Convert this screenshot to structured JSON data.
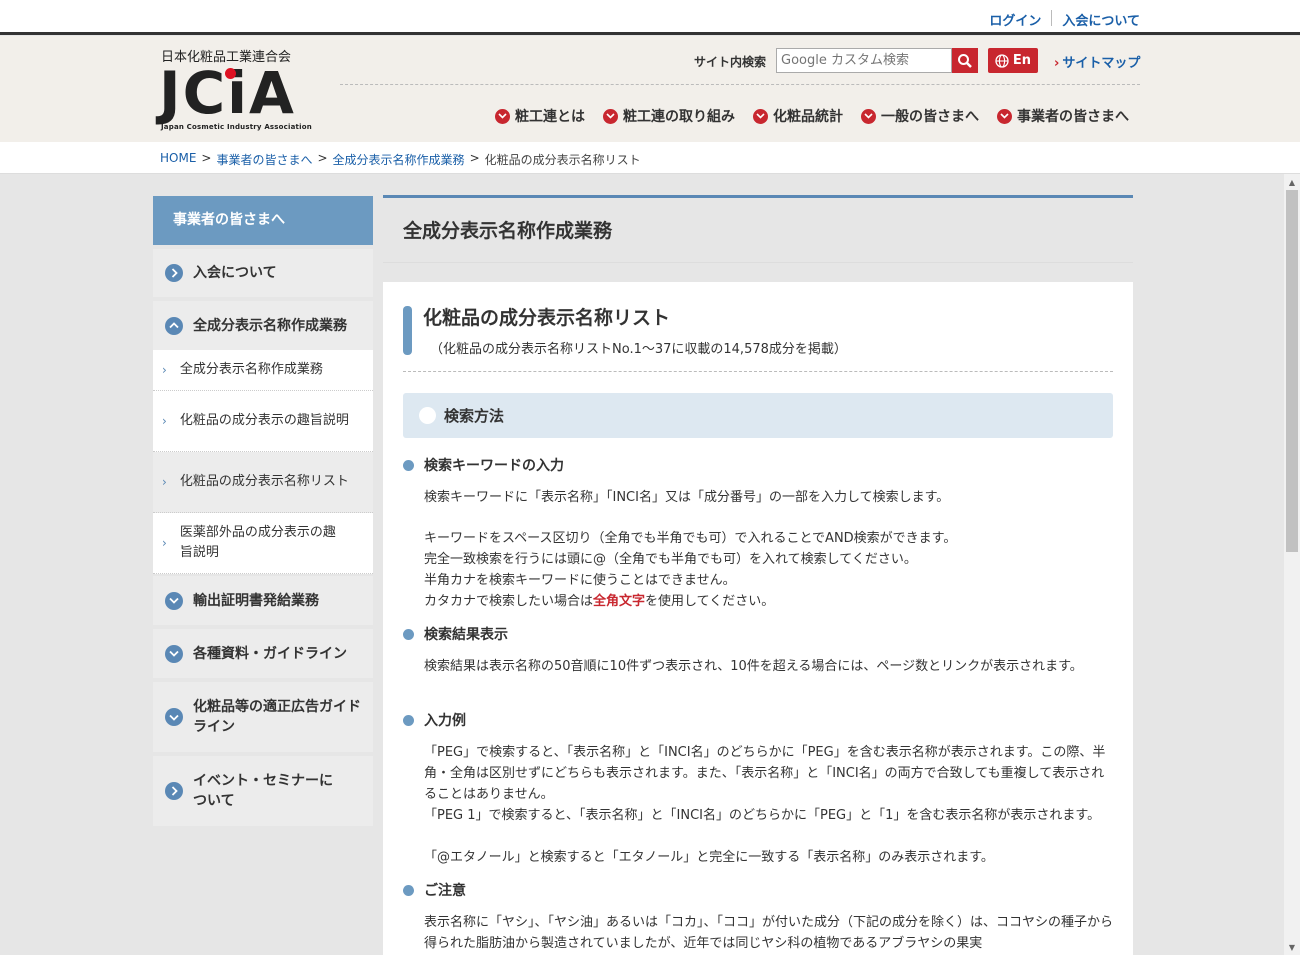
{
  "top_links": [
    "ログイン",
    "入会について"
  ],
  "header": {
    "org_name": "日本化粧品工業連合会",
    "logo_text": "JCiA",
    "logo_sub": "Japan Cosmetic Industry Association",
    "search_label": "サイト内検索",
    "search_placeholder": "Google カスタム検索",
    "en_label": "En",
    "sitemap_label": "サイトマップ"
  },
  "gnav": [
    "粧工連とは",
    "粧工連の取り組み",
    "化粧品統計",
    "一般の皆さまへ",
    "事業者の皆さまへ"
  ],
  "breadcrumb": {
    "home": "HOME",
    "level1": "事業者の皆さまへ",
    "level2": "全成分表示名称作成業務",
    "current": "化粧品の成分表示名称リスト",
    "sep": ">"
  },
  "sidebar": {
    "heading": "事業者の皆さまへ",
    "items": [
      {
        "label": "入会について"
      },
      {
        "label": "全成分表示名称作成業務"
      },
      {
        "label": "全成分表示名称作成業務"
      },
      {
        "label": "化粧品の成分表示の趣旨説明"
      },
      {
        "label": "化粧品の成分表示名称リスト"
      },
      {
        "label": "医薬部外品の成分表示の趣旨説明"
      },
      {
        "label": "輸出証明書発給業務"
      },
      {
        "label": "各種資料・ガイドライン"
      },
      {
        "label": "化粧品等の適正広告ガイドライン"
      },
      {
        "label": "イベント・セミナーについて"
      }
    ]
  },
  "main": {
    "section_title": "全成分表示名称作成業務",
    "page_title": "化粧品の成分表示名称リスト",
    "page_subtitle": "（化粧品の成分表示名称リストNo.1～37に収載の14,578成分を掲載）",
    "h3": "検索方法",
    "sections": [
      {
        "title": "検索キーワードの入力",
        "p1": "検索キーワードに「表示名称」「INCI名」又は「成分番号」の一部を入力して検索します。",
        "l1": "キーワードをスペース区切り（全角でも半角でも可）で入れることでAND検索ができます。",
        "l2": "完全一致検索を行うには頭に@（全角でも半角でも可）を入れて検索してください。",
        "l3": "半角カナを検索キーワードに使うことはできません。",
        "l4a": "カタカナで検索したい場合は",
        "l4b": "全角文字",
        "l4c": "を使用してください。"
      },
      {
        "title": "検索結果表示",
        "p1": "検索結果は表示名称の50音順に10件ずつ表示され、10件を超える場合には、ページ数とリンクが表示されます。"
      },
      {
        "title": "入力例",
        "p1": "「PEG」で検索すると、「表示名称」と「INCI名」のどちらかに「PEG」を含む表示名称が表示されます。この際、半角・全角は区別せずにどちらも表示されます。また、「表示名称」と「INCI名」の両方で合致しても重複して表示されることはありません。",
        "p2": "「PEG 1」で検索すると、「表示名称」と「INCI名」のどちらかに「PEG」と「1」を含む表示名称が表示されます。",
        "p3": "「@エタノール」と検索すると「エタノール」と完全に一致する「表示名称」のみ表示されます。"
      },
      {
        "title": "ご注意",
        "p1": "表示名称に「ヤシ」、「ヤシ油」あるいは「コカ」、「ココ」が付いた成分（下記の成分を除く）は、ココヤシの種子から得られた脂肪油から製造されていましたが、近年では同じヤシ科の植物であるアブラヤシの果実"
      }
    ]
  },
  "colors": {
    "accent": "#6c9ac1",
    "red": "#c8272f",
    "link": "#1a5fa8"
  }
}
